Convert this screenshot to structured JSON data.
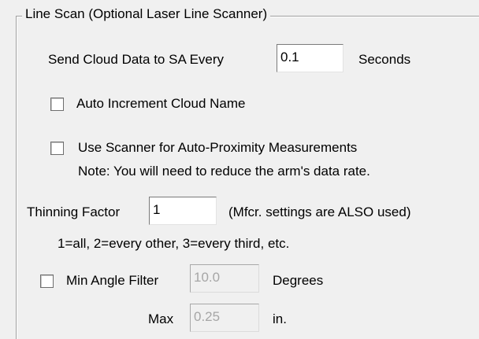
{
  "group": {
    "title": "Line Scan (Optional Laser Line Scanner)"
  },
  "send_cloud": {
    "label": "Send Cloud Data to SA Every",
    "value": "0.1",
    "unit": "Seconds"
  },
  "auto_increment": {
    "label": "Auto Increment Cloud Name",
    "checked": false
  },
  "auto_proximity": {
    "label": "Use Scanner for Auto-Proximity Measurements",
    "note": "Note: You will need to reduce the arm's data rate.",
    "checked": false
  },
  "thinning": {
    "label": "Thinning Factor",
    "value": "1",
    "hint": "(Mfcr. settings are ALSO used)",
    "help": "1=all, 2=every other, 3=every third, etc."
  },
  "min_angle": {
    "label": "Min Angle Filter",
    "value": "10.0",
    "unit": "Degrees",
    "checked": false
  },
  "max_filter": {
    "label": "Max",
    "value": "0.25",
    "unit": "in."
  }
}
